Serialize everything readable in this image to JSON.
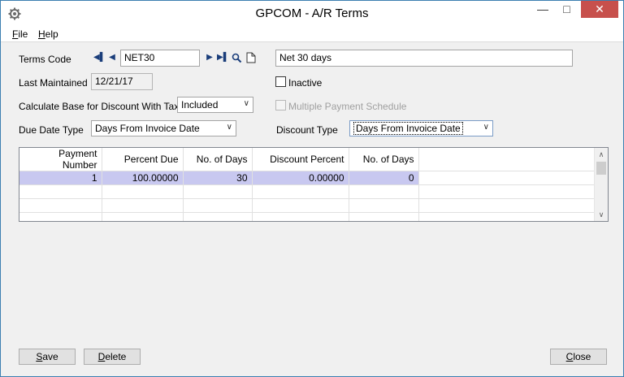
{
  "window": {
    "title": "GPCOM - A/R Terms",
    "minimize_glyph": "—",
    "maximize_glyph": "□",
    "close_glyph": "✕"
  },
  "menu": {
    "file_ul": "F",
    "file_rest": "ile",
    "help_ul": "H",
    "help_rest": "elp"
  },
  "form": {
    "terms_code_label": "Terms Code",
    "terms_code_value": "NET30",
    "description_value": "Net 30 days",
    "last_maintained_label": "Last Maintained",
    "last_maintained_value": "12/21/17",
    "inactive_label": "Inactive",
    "calc_base_label": "Calculate Base for Discount With Tax",
    "calc_base_value": "Included",
    "multiple_payment_label": "Multiple Payment Schedule",
    "due_date_type_label": "Due Date Type",
    "due_date_type_value": "Days From Invoice Date",
    "discount_type_label": "Discount Type",
    "discount_type_value": "Days From Invoice Date"
  },
  "nav": {
    "first": "◀▌",
    "prev": "◀",
    "next": "▶",
    "last": "▶▌"
  },
  "grid": {
    "headers": [
      "Payment Number",
      "Percent Due",
      "No. of Days",
      "Discount Percent",
      "No. of Days"
    ],
    "rows": [
      [
        "1",
        "100.00000",
        "30",
        "0.00000",
        "0"
      ]
    ]
  },
  "buttons": {
    "save_ul": "S",
    "save_rest": "ave",
    "delete_ul": "D",
    "delete_rest": "elete",
    "close_ul": "C",
    "close_rest": "lose"
  },
  "colors": {
    "selected_row": "#c8c8f0",
    "close_button": "#c7504c"
  }
}
